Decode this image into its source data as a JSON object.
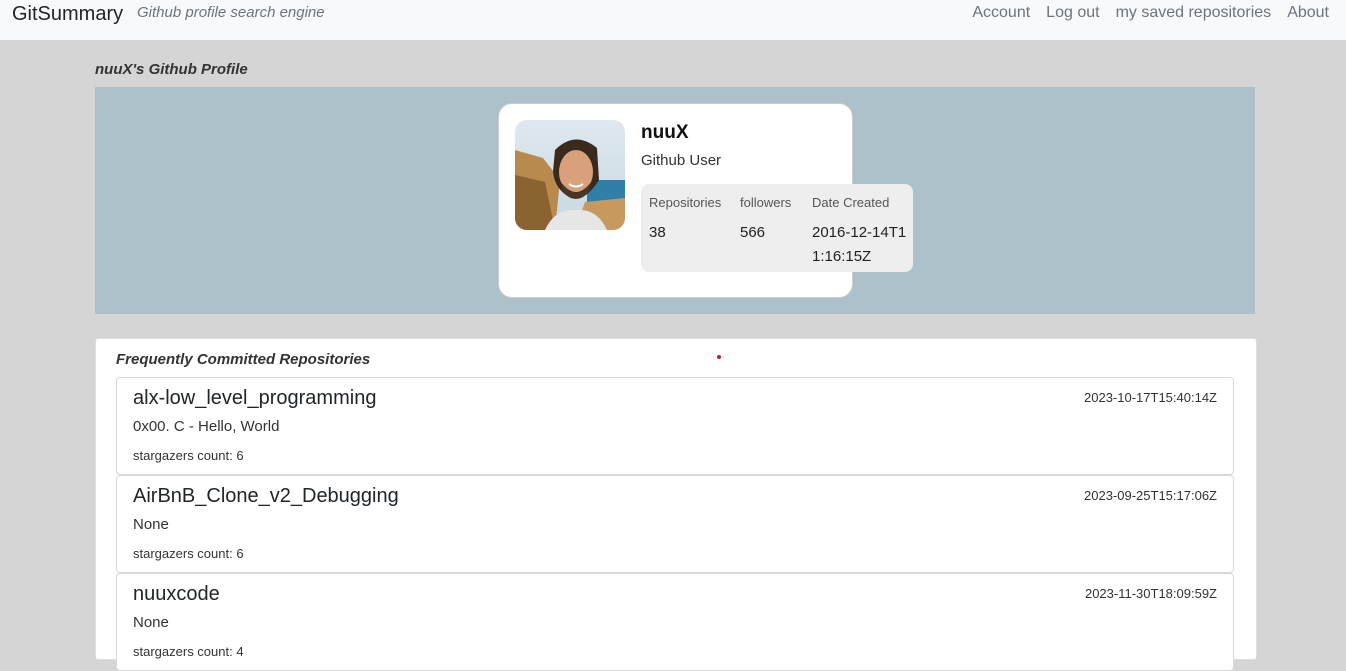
{
  "nav": {
    "brand": "GitSummary",
    "tagline": "Github profile search engine",
    "links": [
      "Account",
      "Log out",
      "my saved repositories",
      "About"
    ]
  },
  "profile": {
    "heading": "nuuX's Github Profile",
    "username": "nuuX",
    "user_type": "Github User",
    "stats": {
      "repos_label": "Repositories",
      "repos_value": "38",
      "followers_label": "followers",
      "followers_value": "566",
      "created_label": "Date Created",
      "created_value": "2016-12-14T11:16:15Z"
    }
  },
  "repos": {
    "heading": "Frequently Committed Repositories",
    "items": [
      {
        "name": "alx-low_level_programming",
        "date": "2023-10-17T15:40:14Z",
        "description": "0x00. C - Hello, World",
        "stars": "stargazers count: 6"
      },
      {
        "name": "AirBnB_Clone_v2_Debugging",
        "date": "2023-09-25T15:17:06Z",
        "description": "None",
        "stars": "stargazers count: 6"
      },
      {
        "name": "nuuxcode",
        "date": "2023-11-30T18:09:59Z",
        "description": "None",
        "stars": "stargazers count: 4"
      }
    ]
  },
  "colors": {
    "banner": "#adc1ca",
    "page_background": "#d5d5d5",
    "navbar": "#f8f9fa"
  }
}
